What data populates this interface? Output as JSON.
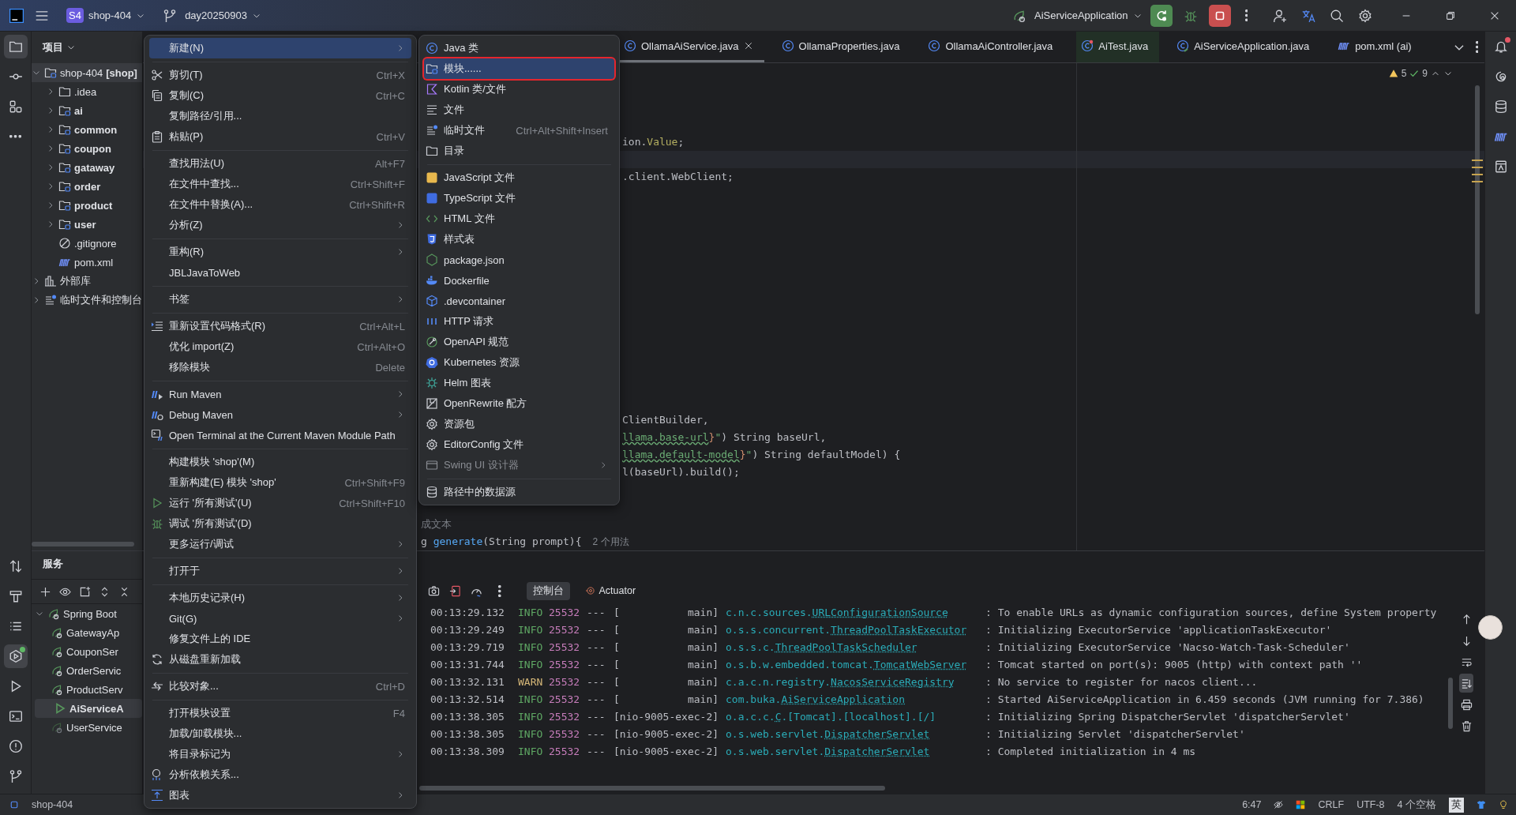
{
  "title_bar": {
    "project_badge": "S4",
    "project": "shop-404",
    "branch": "day20250903",
    "run_config": "AiServiceApplication"
  },
  "tool_strip": {
    "top": [
      {
        "kind": "project",
        "selected": true
      },
      {
        "kind": "commit",
        "selected": false
      },
      {
        "kind": "structure",
        "selected": false
      },
      {
        "kind": "more",
        "selected": false
      }
    ],
    "bottom": [
      {
        "kind": "pull-requests",
        "selected": false
      },
      {
        "kind": "build",
        "selected": false
      },
      {
        "kind": "todo",
        "selected": false
      },
      {
        "kind": "services",
        "selected": true,
        "badge": true
      },
      {
        "kind": "run",
        "selected": false
      },
      {
        "kind": "terminal",
        "selected": false
      },
      {
        "kind": "problems",
        "selected": false
      },
      {
        "kind": "git",
        "selected": false
      }
    ]
  },
  "right_strip": [
    {
      "kind": "notifications",
      "badge": true
    },
    {
      "kind": "ai"
    },
    {
      "kind": "database"
    },
    {
      "kind": "maven"
    },
    {
      "kind": "documentation"
    }
  ],
  "project_panel": {
    "title": "项目",
    "tree": [
      {
        "kind": "root",
        "name": "shop-404",
        "tag": "[shop]",
        "expanded": true,
        "selected": true,
        "children": [
          {
            "kind": "folder",
            "name": ".idea",
            "expanded": false,
            "selected": false
          },
          {
            "kind": "module",
            "name": "ai",
            "expanded": false,
            "selected": false
          },
          {
            "kind": "module",
            "name": "common",
            "expanded": false,
            "selected": false
          },
          {
            "kind": "module",
            "name": "coupon",
            "expanded": false,
            "selected": false
          },
          {
            "kind": "module",
            "name": "gataway",
            "expanded": false,
            "selected": false
          },
          {
            "kind": "module",
            "name": "order",
            "expanded": false,
            "selected": false
          },
          {
            "kind": "module",
            "name": "product",
            "expanded": false,
            "selected": false
          },
          {
            "kind": "module",
            "name": "user",
            "expanded": false,
            "selected": false
          },
          {
            "kind": "ignore",
            "name": ".gitignore",
            "selected": false
          },
          {
            "kind": "maven",
            "name": "pom.xml",
            "selected": false
          }
        ]
      },
      {
        "kind": "library",
        "name": "外部库",
        "expanded": false,
        "selected": false
      },
      {
        "kind": "scratch",
        "name": "临时文件和控制台",
        "expanded": false,
        "selected": false
      }
    ]
  },
  "editor": {
    "tabs": [
      {
        "kind": "class",
        "name": "OllamaAiService.java",
        "selected": true
      },
      {
        "kind": "class",
        "name": "OllamaProperties.java",
        "selected": false
      },
      {
        "kind": "class",
        "name": "OllamaAiController.java",
        "selected": false
      },
      {
        "kind": "test",
        "name": "AiTest.java",
        "selected": false
      },
      {
        "kind": "app",
        "name": "AiServiceApplication.java",
        "selected": false
      },
      {
        "kind": "maven",
        "name": "pom.xml (ai)",
        "selected": false
      }
    ],
    "warnings": "5",
    "passed": "9",
    "lines": [
      {
        "current": false
      },
      {
        "current": false
      },
      {
        "current": false
      },
      {
        "current": false
      },
      {
        "current": false,
        "segments": [
          {
            "kind": "plain",
            "text": "ion."
          },
          {
            "kind": "annotation",
            "text": "Value"
          },
          {
            "kind": "plain",
            "text": ";"
          }
        ]
      },
      {
        "current": true
      },
      {
        "current": false,
        "segments": [
          {
            "kind": "plain",
            "text": ".client.WebClient;"
          }
        ]
      },
      {
        "current": false
      },
      {
        "current": false
      },
      {
        "current": false
      },
      {
        "current": false
      },
      {
        "current": false
      },
      {
        "current": false
      },
      {
        "current": false
      },
      {
        "current": false
      },
      {
        "current": false
      },
      {
        "current": false
      },
      {
        "current": false
      },
      {
        "current": false
      },
      {
        "current": false
      },
      {
        "current": false,
        "segments": [
          {
            "kind": "plain",
            "text": "ClientBuilder,"
          }
        ]
      },
      {
        "current": false,
        "segments": [
          {
            "kind": "link",
            "text": "llama.base-url"
          },
          {
            "kind": "brace",
            "text": "}"
          },
          {
            "kind": "string",
            "text": "\""
          },
          {
            "kind": "plain",
            "text": ") String baseUrl,"
          }
        ]
      },
      {
        "current": false,
        "segments": [
          {
            "kind": "link",
            "text": "llama.default-model"
          },
          {
            "kind": "brace",
            "text": "}"
          },
          {
            "kind": "string",
            "text": "\""
          },
          {
            "kind": "plain",
            "text": ") String defaultModel) {"
          }
        ]
      },
      {
        "current": false,
        "segments": [
          {
            "kind": "plain",
            "text": "l(baseUrl).build();"
          }
        ]
      },
      {
        "current": false
      },
      {
        "current": false
      },
      {
        "current": false,
        "segments": [
          {
            "kind": "comment",
            "text": "成文本"
          }
        ]
      },
      {
        "current": false,
        "segments": [
          {
            "kind": "plain",
            "text": "g "
          },
          {
            "kind": "method",
            "text": "generate"
          },
          {
            "kind": "plain",
            "text": "(String prompt){"
          }
        ],
        "hint": "2 个用法"
      }
    ]
  },
  "context_menu": {
    "items": [
      {
        "kind": "plain",
        "label": "新建(N)",
        "selected": true,
        "submenu": true
      },
      {
        "kind": "separator"
      },
      {
        "kind": "scissors",
        "label": "剪切(T)",
        "shortcut": "Ctrl+X",
        "selected": false
      },
      {
        "kind": "copy",
        "label": "复制(C)",
        "shortcut": "Ctrl+C",
        "selected": false
      },
      {
        "kind": "plain",
        "label": "复制路径/引用...",
        "selected": false
      },
      {
        "kind": "paste",
        "label": "粘贴(P)",
        "shortcut": "Ctrl+V",
        "selected": false
      },
      {
        "kind": "separator"
      },
      {
        "kind": "plain",
        "label": "查找用法(U)",
        "shortcut": "Alt+F7",
        "selected": false
      },
      {
        "kind": "plain",
        "label": "在文件中查找...",
        "shortcut": "Ctrl+Shift+F",
        "selected": false
      },
      {
        "kind": "plain",
        "label": "在文件中替换(A)...",
        "shortcut": "Ctrl+Shift+R",
        "selected": false
      },
      {
        "kind": "plain",
        "label": "分析(Z)",
        "selected": false,
        "submenu": true
      },
      {
        "kind": "separator"
      },
      {
        "kind": "plain",
        "label": "重构(R)",
        "selected": false,
        "submenu": true
      },
      {
        "kind": "plain",
        "label": "JBLJavaToWeb",
        "selected": false
      },
      {
        "kind": "separator"
      },
      {
        "kind": "plain",
        "label": "书签",
        "selected": false,
        "submenu": true
      },
      {
        "kind": "separator"
      },
      {
        "kind": "format",
        "label": "重新设置代码格式(R)",
        "shortcut": "Ctrl+Alt+L",
        "selected": false
      },
      {
        "kind": "plain",
        "label": "优化 import(Z)",
        "shortcut": "Ctrl+Alt+O",
        "selected": false
      },
      {
        "kind": "plain",
        "label": "移除模块",
        "shortcut": "Delete",
        "selected": false
      },
      {
        "kind": "separator"
      },
      {
        "kind": "maven-run",
        "label": "Run Maven",
        "selected": false,
        "submenu": true
      },
      {
        "kind": "maven-debug",
        "label": "Debug Maven",
        "selected": false,
        "submenu": true
      },
      {
        "kind": "maven-terminal",
        "label": "Open Terminal at the Current Maven Module Path",
        "selected": false
      },
      {
        "kind": "separator"
      },
      {
        "kind": "plain",
        "label": "构建模块 'shop'(M)",
        "selected": false
      },
      {
        "kind": "plain",
        "label": "重新构建(E) 模块 'shop'",
        "shortcut": "Ctrl+Shift+F9",
        "selected": false
      },
      {
        "kind": "play",
        "label": "运行 '所有测试'(U)",
        "shortcut": "Ctrl+Shift+F10",
        "selected": false
      },
      {
        "kind": "bug",
        "label": "调试 '所有测试'(D)",
        "selected": false
      },
      {
        "kind": "plain",
        "label": "更多运行/调试",
        "selected": false,
        "submenu": true
      },
      {
        "kind": "separator"
      },
      {
        "kind": "plain",
        "label": "打开于",
        "selected": false,
        "submenu": true
      },
      {
        "kind": "separator"
      },
      {
        "kind": "plain",
        "label": "本地历史记录(H)",
        "selected": false,
        "submenu": true
      },
      {
        "kind": "plain",
        "label": "Git(G)",
        "selected": false,
        "submenu": true
      },
      {
        "kind": "plain",
        "label": "修复文件上的 IDE",
        "selected": false
      },
      {
        "kind": "reload",
        "label": "从磁盘重新加载",
        "selected": false
      },
      {
        "kind": "separator"
      },
      {
        "kind": "compare",
        "label": "比较对象...",
        "shortcut": "Ctrl+D",
        "selected": false
      },
      {
        "kind": "separator"
      },
      {
        "kind": "plain",
        "label": "打开模块设置",
        "shortcut": "F4",
        "selected": false
      },
      {
        "kind": "plain",
        "label": "加载/卸载模块...",
        "selected": false
      },
      {
        "kind": "plain",
        "label": "将目录标记为",
        "selected": false,
        "submenu": true
      },
      {
        "kind": "deps",
        "label": "分析依赖关系...",
        "selected": false
      },
      {
        "kind": "diagram",
        "label": "图表",
        "selected": false,
        "submenu": true
      }
    ]
  },
  "new_submenu": {
    "items": [
      {
        "kind": "java-class",
        "label": "Java 类",
        "selected": false,
        "disabled": false
      },
      {
        "kind": "module",
        "label": "模块......",
        "selected": true,
        "marked": true,
        "disabled": false
      },
      {
        "kind": "kotlin",
        "label": "Kotlin 类/文件",
        "selected": false,
        "disabled": false
      },
      {
        "kind": "file",
        "label": "文件",
        "selected": false,
        "disabled": false
      },
      {
        "kind": "scratch",
        "label": "临时文件",
        "shortcut": "Ctrl+Alt+Shift+Insert",
        "selected": false,
        "disabled": false
      },
      {
        "kind": "folder",
        "label": "目录",
        "selected": false,
        "disabled": false
      },
      {
        "kind": "separator"
      },
      {
        "kind": "js",
        "label": "JavaScript 文件",
        "selected": false,
        "disabled": false
      },
      {
        "kind": "ts",
        "label": "TypeScript 文件",
        "selected": false,
        "disabled": false
      },
      {
        "kind": "html",
        "label": "HTML 文件",
        "selected": false,
        "disabled": false
      },
      {
        "kind": "css",
        "label": "样式表",
        "selected": false,
        "disabled": false
      },
      {
        "kind": "nodejs",
        "label": "package.json",
        "selected": false,
        "disabled": false
      },
      {
        "kind": "docker",
        "label": "Dockerfile",
        "selected": false,
        "disabled": false
      },
      {
        "kind": "cube",
        "label": ".devcontainer",
        "selected": false,
        "disabled": false
      },
      {
        "kind": "api",
        "label": "HTTP 请求",
        "selected": false,
        "disabled": false
      },
      {
        "kind": "openapi",
        "label": "OpenAPI 规范",
        "selected": false,
        "disabled": false
      },
      {
        "kind": "k8s",
        "label": "Kubernetes 资源",
        "selected": false,
        "disabled": false
      },
      {
        "kind": "helm",
        "label": "Helm 图表",
        "selected": false,
        "disabled": false
      },
      {
        "kind": "openrewrite",
        "label": "OpenRewrite 配方",
        "selected": false,
        "disabled": false
      },
      {
        "kind": "gear",
        "label": "资源包",
        "selected": false,
        "disabled": false
      },
      {
        "kind": "gear",
        "label": "EditorConfig 文件",
        "selected": false,
        "disabled": false
      },
      {
        "kind": "window",
        "label": "Swing UI 设计器",
        "selected": false,
        "disabled": true,
        "submenu": true
      },
      {
        "kind": "separator"
      },
      {
        "kind": "database",
        "label": "路径中的数据源",
        "selected": false,
        "disabled": false
      }
    ]
  },
  "services_panel": {
    "title": "服务",
    "tree": [
      {
        "kind": "group",
        "name": "Spring Boot",
        "expanded": true,
        "selected": false,
        "children": [
          {
            "kind": "idle",
            "name": "GatewayAp",
            "selected": false
          },
          {
            "kind": "idle",
            "name": "CouponSer",
            "selected": false
          },
          {
            "kind": "idle",
            "name": "OrderServic",
            "selected": false
          },
          {
            "kind": "idle",
            "name": "ProductServ",
            "selected": false
          },
          {
            "kind": "running",
            "name": "AiServiceA",
            "selected": true
          },
          {
            "kind": "inactive",
            "name": "UserService",
            "selected": false
          }
        ]
      }
    ]
  },
  "console": {
    "tabs": [
      {
        "kind": "console",
        "label": "控制台",
        "selected": true
      },
      {
        "kind": "actuator",
        "label": "Actuator",
        "selected": false
      }
    ],
    "tools": [
      {
        "kind": "up",
        "selected": false
      },
      {
        "kind": "down",
        "selected": false
      },
      {
        "kind": "wrap",
        "selected": false
      },
      {
        "kind": "scroll-end",
        "selected": true
      },
      {
        "kind": "print",
        "selected": false
      },
      {
        "kind": "clear",
        "selected": false
      }
    ],
    "lines": [
      {
        "time": "00:13:29.132",
        "kind": "info",
        "severity": "INFO",
        "pid": "25532",
        "separator": "---",
        "thread": "[           main]",
        "package": "c.n.c.sources.",
        "class": "URLConfigurationSource",
        "message": ": To enable URLs as dynamic configuration sources, define System property"
      },
      {
        "time": "00:13:29.249",
        "kind": "info",
        "severity": "INFO",
        "pid": "25532",
        "separator": "---",
        "thread": "[           main]",
        "package": "o.s.s.concurrent.",
        "class": "ThreadPoolTaskExecutor",
        "message": ": Initializing ExecutorService 'applicationTaskExecutor'"
      },
      {
        "time": "00:13:29.719",
        "kind": "info",
        "severity": "INFO",
        "pid": "25532",
        "separator": "---",
        "thread": "[           main]",
        "package": "o.s.s.c.",
        "class": "ThreadPoolTaskScheduler",
        "message": ": Initializing ExecutorService 'Nacso-Watch-Task-Scheduler'"
      },
      {
        "time": "00:13:31.744",
        "kind": "info",
        "severity": "INFO",
        "pid": "25532",
        "separator": "---",
        "thread": "[           main]",
        "package": "o.s.b.w.embedded.tomcat.",
        "class": "TomcatWebServer",
        "message": ": Tomcat started on port(s): 9005 (http) with context path ''"
      },
      {
        "time": "00:13:32.131",
        "kind": "warn",
        "severity": "WARN",
        "pid": "25532",
        "separator": "---",
        "thread": "[           main]",
        "package": "c.a.c.n.registry.",
        "class": "NacosServiceRegistry",
        "message": ": No service to register for nacos client..."
      },
      {
        "time": "00:13:32.514",
        "kind": "info",
        "severity": "INFO",
        "pid": "25532",
        "separator": "---",
        "thread": "[           main]",
        "package": "com.buka.",
        "class": "AiServiceApplication",
        "message": ": Started AiServiceApplication in 6.459 seconds (JVM running for 7.386)"
      },
      {
        "time": "00:13:38.305",
        "kind": "info",
        "severity": "INFO",
        "pid": "25532",
        "separator": "---",
        "thread": "[nio-9005-exec-2]",
        "package": "o.a.c.c.",
        "class": "C",
        "suffix": ".[Tomcat].[localhost].[/]",
        "message": ": Initializing Spring DispatcherServlet 'dispatcherServlet'"
      },
      {
        "time": "00:13:38.305",
        "kind": "info",
        "severity": "INFO",
        "pid": "25532",
        "separator": "---",
        "thread": "[nio-9005-exec-2]",
        "package": "o.s.web.servlet.",
        "class": "DispatcherServlet",
        "message": ": Initializing Servlet 'dispatcherServlet'"
      },
      {
        "time": "00:13:38.309",
        "kind": "info",
        "severity": "INFO",
        "pid": "25532",
        "separator": "---",
        "thread": "[nio-9005-exec-2]",
        "package": "o.s.web.servlet.",
        "class": "DispatcherServlet",
        "message": ": Completed initialization in 4 ms"
      }
    ]
  },
  "status_bar": {
    "project": "shop-404",
    "position": "6:47",
    "line_separator": "CRLF",
    "encoding": "UTF-8",
    "indent": "4 个空格",
    "input_method": "英"
  }
}
